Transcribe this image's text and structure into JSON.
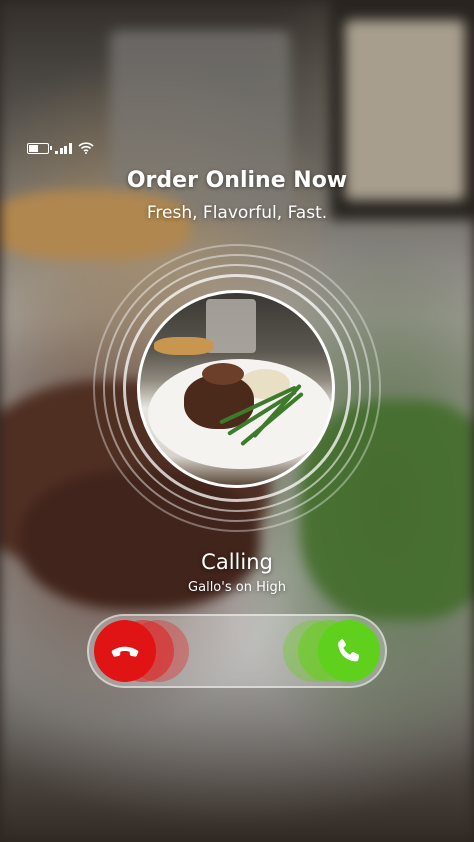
{
  "status_bar": {
    "battery_icon": "battery-icon",
    "signal_icon": "signal-icon",
    "wifi_icon": "wifi-icon"
  },
  "header": {
    "title": "Order Online Now",
    "subtitle": "Fresh, Flavorful, Fast."
  },
  "call": {
    "status": "Calling",
    "caller_name": "Gallo's on High"
  },
  "controls": {
    "decline_icon": "hang-up-icon",
    "accept_icon": "phone-icon",
    "decline_color": "#e01414",
    "accept_color": "#5fd11c"
  }
}
